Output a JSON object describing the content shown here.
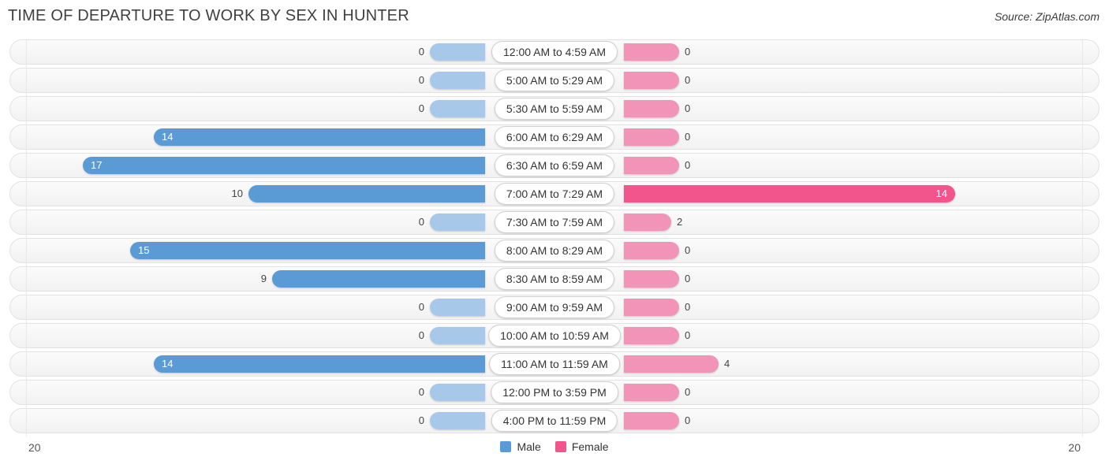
{
  "header": {
    "title": "TIME OF DEPARTURE TO WORK BY SEX IN HUNTER",
    "source": "Source: ZipAtlas.com"
  },
  "colors": {
    "male": "#5b9bd5",
    "male_light": "#a8c8ea",
    "female": "#f2558c",
    "female_light": "#f294b8",
    "track": "#f5f5f5",
    "track_border": "#e2e2e2"
  },
  "legend": {
    "items": [
      {
        "label": "Male",
        "color": "#5b9bd5"
      },
      {
        "label": "Female",
        "color": "#f2558c"
      }
    ]
  },
  "axis": {
    "left_max": "20",
    "right_max": "20"
  },
  "chart_data": {
    "type": "bar",
    "subtype": "diverging-bidirectional-bar",
    "title": "TIME OF DEPARTURE TO WORK BY SEX IN HUNTER",
    "xlabel": "",
    "ylabel": "",
    "xlim": [
      20,
      20
    ],
    "grid": false,
    "legend_position": "bottom-center",
    "categories": [
      "12:00 AM to 4:59 AM",
      "5:00 AM to 5:29 AM",
      "5:30 AM to 5:59 AM",
      "6:00 AM to 6:29 AM",
      "6:30 AM to 6:59 AM",
      "7:00 AM to 7:29 AM",
      "7:30 AM to 7:59 AM",
      "8:00 AM to 8:29 AM",
      "8:30 AM to 8:59 AM",
      "9:00 AM to 9:59 AM",
      "10:00 AM to 10:59 AM",
      "11:00 AM to 11:59 AM",
      "12:00 PM to 3:59 PM",
      "4:00 PM to 11:59 PM"
    ],
    "series": [
      {
        "name": "Male",
        "color": "#5b9bd5",
        "values": [
          0,
          0,
          0,
          14,
          17,
          10,
          0,
          15,
          9,
          0,
          0,
          14,
          0,
          0
        ]
      },
      {
        "name": "Female",
        "color": "#f2558c",
        "values": [
          0,
          0,
          0,
          0,
          0,
          14,
          2,
          0,
          0,
          0,
          0,
          4,
          0,
          0
        ]
      }
    ]
  },
  "rows": [
    {
      "label": "12:00 AM to 4:59 AM",
      "male": "0",
      "female": "0"
    },
    {
      "label": "5:00 AM to 5:29 AM",
      "male": "0",
      "female": "0"
    },
    {
      "label": "5:30 AM to 5:59 AM",
      "male": "0",
      "female": "0"
    },
    {
      "label": "6:00 AM to 6:29 AM",
      "male": "14",
      "female": "0"
    },
    {
      "label": "6:30 AM to 6:59 AM",
      "male": "17",
      "female": "0"
    },
    {
      "label": "7:00 AM to 7:29 AM",
      "male": "10",
      "female": "14"
    },
    {
      "label": "7:30 AM to 7:59 AM",
      "male": "0",
      "female": "2"
    },
    {
      "label": "8:00 AM to 8:29 AM",
      "male": "15",
      "female": "0"
    },
    {
      "label": "8:30 AM to 8:59 AM",
      "male": "9",
      "female": "0"
    },
    {
      "label": "9:00 AM to 9:59 AM",
      "male": "0",
      "female": "0"
    },
    {
      "label": "10:00 AM to 10:59 AM",
      "male": "0",
      "female": "0"
    },
    {
      "label": "11:00 AM to 11:59 AM",
      "male": "14",
      "female": "4"
    },
    {
      "label": "12:00 PM to 3:59 PM",
      "male": "0",
      "female": "0"
    },
    {
      "label": "4:00 PM to 11:59 PM",
      "male": "0",
      "female": "0"
    }
  ]
}
